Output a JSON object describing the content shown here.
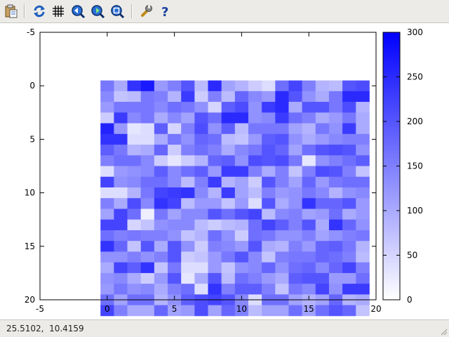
{
  "toolbar": {
    "buttons": [
      {
        "name": "copy-clipboard",
        "icon": "clipboard-icon"
      },
      {
        "name": "replot",
        "icon": "refresh-icon"
      },
      {
        "name": "toggle-grid",
        "icon": "grid-icon"
      },
      {
        "name": "previous-zoom",
        "icon": "zoom-back-icon"
      },
      {
        "name": "next-zoom",
        "icon": "zoom-forward-icon"
      },
      {
        "name": "autoscale",
        "icon": "zoom-autoscale-icon"
      },
      {
        "name": "options",
        "icon": "wrench-icon"
      },
      {
        "name": "help",
        "icon": "help-icon"
      }
    ]
  },
  "status": {
    "coords": "25.5102,  10.4159"
  },
  "chart_data": {
    "type": "heatmap",
    "xlim": [
      -5,
      20
    ],
    "ylim": [
      -5,
      20
    ],
    "y_reversed": true,
    "xticks": [
      "-5",
      "0",
      "5",
      "10",
      "15",
      "20"
    ],
    "yticks": [
      "-5",
      "0",
      "5",
      "10",
      "15",
      "20"
    ],
    "x_origin": 0,
    "y_origin": 0,
    "colorbar": {
      "min": 0,
      "max": 300,
      "ticks": [
        "0",
        "50",
        "100",
        "150",
        "200",
        "250",
        "300"
      ],
      "low_color": "#ffffff",
      "high_color": "#0000ff"
    },
    "values": [
      [
        160,
        100,
        240,
        270,
        120,
        150,
        200,
        80,
        250,
        110,
        90,
        60,
        40,
        170,
        220,
        150,
        90,
        80,
        200,
        210
      ],
      [
        140,
        70,
        80,
        160,
        150,
        90,
        230,
        60,
        150,
        80,
        180,
        140,
        120,
        250,
        200,
        130,
        100,
        160,
        250,
        250
      ],
      [
        120,
        160,
        160,
        160,
        140,
        170,
        160,
        130,
        50,
        190,
        210,
        130,
        230,
        250,
        100,
        200,
        200,
        160,
        210,
        90
      ],
      [
        60,
        230,
        140,
        160,
        100,
        140,
        110,
        200,
        170,
        250,
        250,
        130,
        140,
        230,
        170,
        150,
        100,
        120,
        160,
        100
      ],
      [
        260,
        120,
        30,
        40,
        190,
        50,
        150,
        210,
        130,
        190,
        80,
        160,
        160,
        160,
        110,
        90,
        160,
        130,
        230,
        100
      ],
      [
        240,
        240,
        40,
        40,
        100,
        160,
        130,
        180,
        170,
        80,
        70,
        120,
        190,
        200,
        130,
        100,
        120,
        140,
        150,
        150
      ],
      [
        190,
        160,
        90,
        100,
        180,
        60,
        150,
        170,
        150,
        100,
        140,
        160,
        200,
        180,
        110,
        170,
        200,
        210,
        200,
        130
      ],
      [
        150,
        170,
        170,
        140,
        60,
        30,
        60,
        90,
        180,
        190,
        130,
        210,
        200,
        210,
        160,
        30,
        130,
        150,
        170,
        190
      ],
      [
        40,
        120,
        130,
        140,
        190,
        140,
        170,
        190,
        120,
        230,
        230,
        150,
        100,
        150,
        70,
        150,
        210,
        200,
        150,
        70
      ],
      [
        220,
        130,
        140,
        170,
        170,
        140,
        80,
        150,
        230,
        90,
        110,
        60,
        200,
        150,
        110,
        180,
        120,
        160,
        170,
        170
      ],
      [
        40,
        40,
        90,
        160,
        220,
        230,
        240,
        140,
        90,
        230,
        110,
        80,
        150,
        120,
        130,
        160,
        140,
        90,
        130,
        140
      ],
      [
        150,
        100,
        210,
        140,
        240,
        220,
        80,
        120,
        120,
        70,
        120,
        40,
        200,
        100,
        130,
        240,
        180,
        180,
        200,
        120
      ],
      [
        110,
        220,
        170,
        20,
        160,
        110,
        140,
        140,
        200,
        170,
        200,
        220,
        80,
        140,
        150,
        110,
        120,
        170,
        100,
        120
      ],
      [
        220,
        220,
        50,
        70,
        130,
        140,
        140,
        80,
        60,
        80,
        90,
        170,
        220,
        190,
        150,
        200,
        100,
        240,
        180,
        130
      ],
      [
        170,
        150,
        160,
        150,
        150,
        130,
        70,
        90,
        170,
        130,
        60,
        170,
        160,
        130,
        130,
        150,
        110,
        130,
        150,
        160
      ],
      [
        240,
        180,
        70,
        200,
        100,
        200,
        130,
        60,
        150,
        140,
        120,
        200,
        100,
        90,
        150,
        120,
        180,
        190,
        160,
        90
      ],
      [
        130,
        130,
        150,
        130,
        150,
        200,
        60,
        70,
        120,
        160,
        200,
        140,
        70,
        150,
        160,
        160,
        180,
        170,
        150,
        80
      ],
      [
        100,
        220,
        190,
        240,
        70,
        160,
        40,
        40,
        120,
        70,
        130,
        140,
        180,
        130,
        170,
        180,
        140,
        180,
        220,
        150
      ],
      [
        130,
        140,
        100,
        60,
        120,
        200,
        30,
        100,
        200,
        80,
        170,
        150,
        120,
        100,
        190,
        200,
        200,
        120,
        120,
        170
      ],
      [
        120,
        160,
        130,
        140,
        100,
        150,
        170,
        40,
        240,
        150,
        190,
        190,
        150,
        70,
        160,
        140,
        220,
        130,
        230,
        230
      ],
      [
        170,
        110,
        170,
        170,
        90,
        130,
        190,
        210,
        220,
        200,
        140,
        40,
        170,
        170,
        110,
        90,
        110,
        180,
        90,
        100
      ],
      [
        220,
        150,
        100,
        100,
        180,
        110,
        120,
        210,
        110,
        180,
        150,
        80,
        110,
        110,
        170,
        110,
        170,
        200,
        180,
        70
      ]
    ]
  }
}
